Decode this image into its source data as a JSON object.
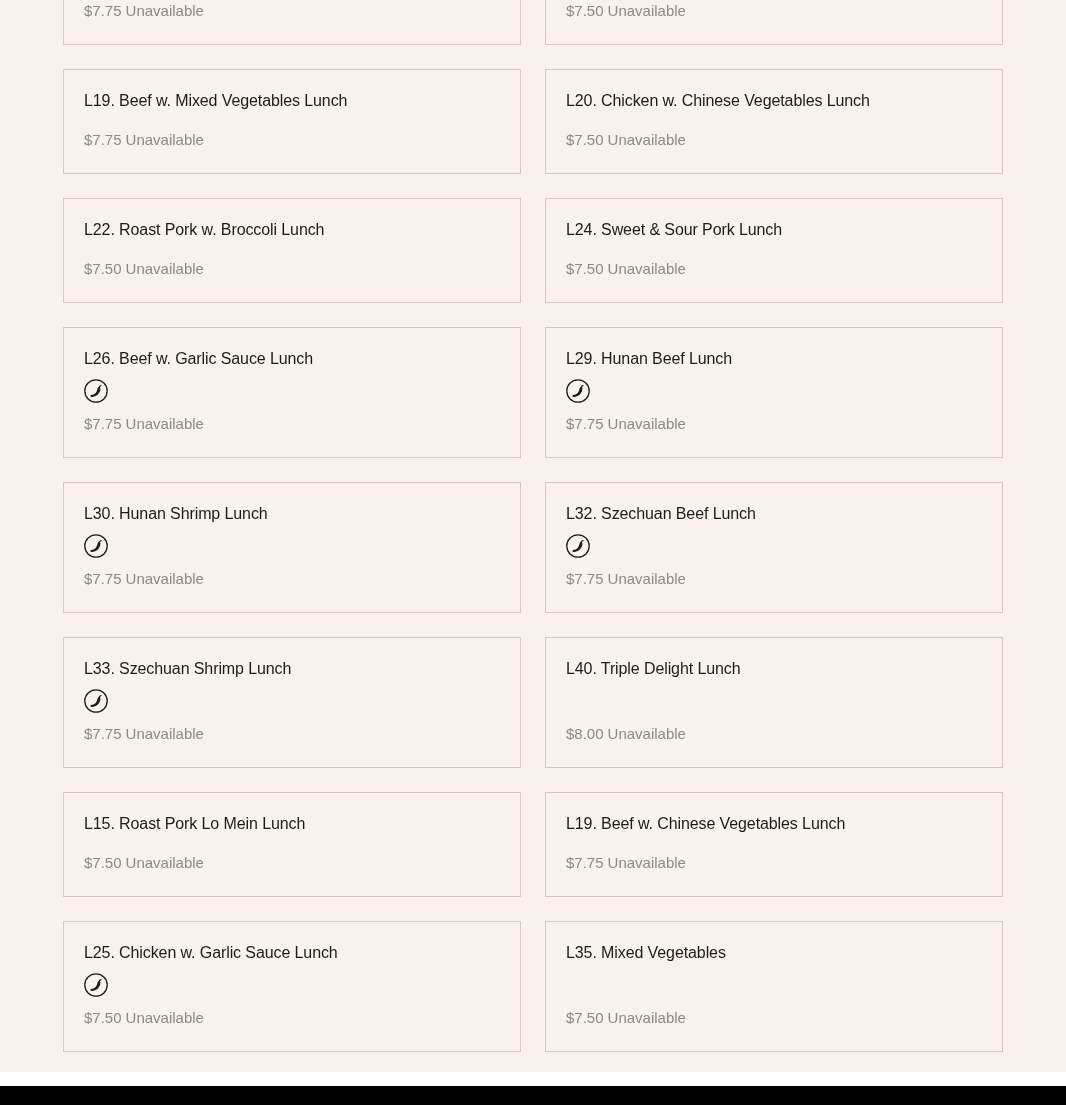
{
  "menu_items": [
    {
      "price": "$7.75",
      "status": "Unavailable",
      "spicy": false
    },
    {
      "price": "$7.50",
      "status": "Unavailable",
      "spicy": false
    },
    {
      "name": "L19. Beef w. Mixed Vegetables Lunch",
      "price": "$7.75",
      "status": "Unavailable",
      "spicy": false
    },
    {
      "name": "L20. Chicken w. Chinese Vegetables Lunch",
      "price": "$7.50",
      "status": "Unavailable",
      "spicy": false
    },
    {
      "name": "L22. Roast Pork w. Broccoli Lunch",
      "price": "$7.50",
      "status": "Unavailable",
      "spicy": false
    },
    {
      "name": "L24. Sweet & Sour Pork Lunch",
      "price": "$7.50",
      "status": "Unavailable",
      "spicy": false
    },
    {
      "name": "L26. Beef w. Garlic Sauce Lunch",
      "price": "$7.75",
      "status": "Unavailable",
      "spicy": true
    },
    {
      "name": "L29. Hunan Beef Lunch",
      "price": "$7.75",
      "status": "Unavailable",
      "spicy": true
    },
    {
      "name": "L30. Hunan Shrimp Lunch",
      "price": "$7.75",
      "status": "Unavailable",
      "spicy": true
    },
    {
      "name": "L32. Szechuan Beef Lunch",
      "price": "$7.75",
      "status": "Unavailable",
      "spicy": true
    },
    {
      "name": "L33. Szechuan Shrimp Lunch",
      "price": "$7.75",
      "status": "Unavailable",
      "spicy": true
    },
    {
      "name": "L40. Triple Delight Lunch",
      "price": "$8.00",
      "status": "Unavailable",
      "spicy": false
    },
    {
      "name": "L15. Roast Pork Lo Mein Lunch",
      "price": "$7.50",
      "status": "Unavailable",
      "spicy": false
    },
    {
      "name": "L19. Beef w. Chinese Vegetables Lunch",
      "price": "$7.75",
      "status": "Unavailable",
      "spicy": false
    },
    {
      "name": "L25. Chicken w. Garlic Sauce Lunch",
      "price": "$7.50",
      "status": "Unavailable",
      "spicy": true
    },
    {
      "name": "L35. Mixed Vegetables",
      "price": "$7.50",
      "status": "Unavailable",
      "spicy": false
    }
  ]
}
